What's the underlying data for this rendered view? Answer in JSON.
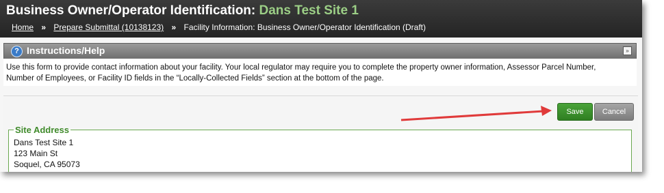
{
  "header": {
    "title_prefix": "Business Owner/Operator Identification:",
    "site_name": "Dans Test Site 1"
  },
  "breadcrumb": {
    "home": "Home",
    "sep1": "»",
    "submittal": "Prepare Submittal (10138123)",
    "sep2": "»",
    "current": "Facility Information: Business Owner/Operator Identification (Draft)"
  },
  "help": {
    "icon": "?",
    "title": "Instructions/Help",
    "collapse_icon": "»",
    "line1": "Use this form to provide contact information about your facility. Your local regulator may require you to complete the property owner information, Assessor Parcel Number,",
    "line2": "Number of Employees, or Facility ID fields in the “Locally-Collected Fields” section at the bottom of the page."
  },
  "toolbar": {
    "save_label": "Save",
    "cancel_label": "Cancel"
  },
  "site_address": {
    "legend": "Site Address",
    "line1": "Dans Test Site 1",
    "line2": "123 Main St",
    "line3": "Soquel, CA  95073"
  },
  "colors": {
    "header_bg": "#2e2e2e",
    "site_name": "#9ccf86",
    "save_button": "#3a8f2c",
    "cancel_button": "#8f8f8f",
    "annotation_arrow": "#e03a3a",
    "legend": "#3f8a2a"
  }
}
